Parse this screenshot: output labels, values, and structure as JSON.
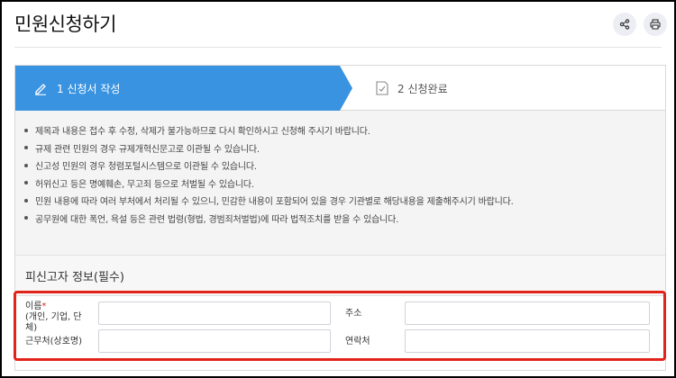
{
  "page": {
    "title": "민원신청하기"
  },
  "header_actions": {
    "share_icon": "share-icon",
    "print_icon": "print-icon"
  },
  "steps": [
    {
      "number": "1",
      "label": "1 신청서 작성",
      "active": true,
      "icon": "pencil-icon"
    },
    {
      "number": "2",
      "label": "2 신청완료",
      "active": false,
      "icon": "document-check-icon"
    }
  ],
  "notices": [
    "제목과 내용은 접수 후 수정, 삭제가 불가능하므로 다시 확인하시고 신청해 주시기 바랍니다.",
    "규제 관련 민원의 경우 규제개혁신문고로 이관될 수 있습니다.",
    "신고성 민원의 경우 청렴포털시스템으로 이관될 수 있습니다.",
    "허위신고 등은 명예훼손, 무고죄 등으로 처벌될 수 있습니다.",
    "민원 내용에 따라 여러 부처에서 처리될 수 있으니, 민감한 내용이 포함되어 있을 경우 기관별로 해당내용을 제출해주시기 바랍니다.",
    "공무원에 대한 폭언, 욕설 등은 관련 법령(형법, 경범죄처벌법)에 따라 법적조치를 받을 수 있습니다."
  ],
  "section": {
    "title": "피신고자 정보(필수)"
  },
  "form": {
    "name_label": "이름",
    "required_mark": "*",
    "name_sublabel": "(개인, 기업, 단체)",
    "address_label": "주소",
    "workplace_label": "근무처(상호명)",
    "contact_label": "연락처",
    "name_value": "",
    "address_value": "",
    "workplace_value": "",
    "contact_value": ""
  },
  "colors": {
    "step_active": "#3a93e0",
    "highlight_border": "#e2231a",
    "notice_bg": "#f4f4f4"
  }
}
